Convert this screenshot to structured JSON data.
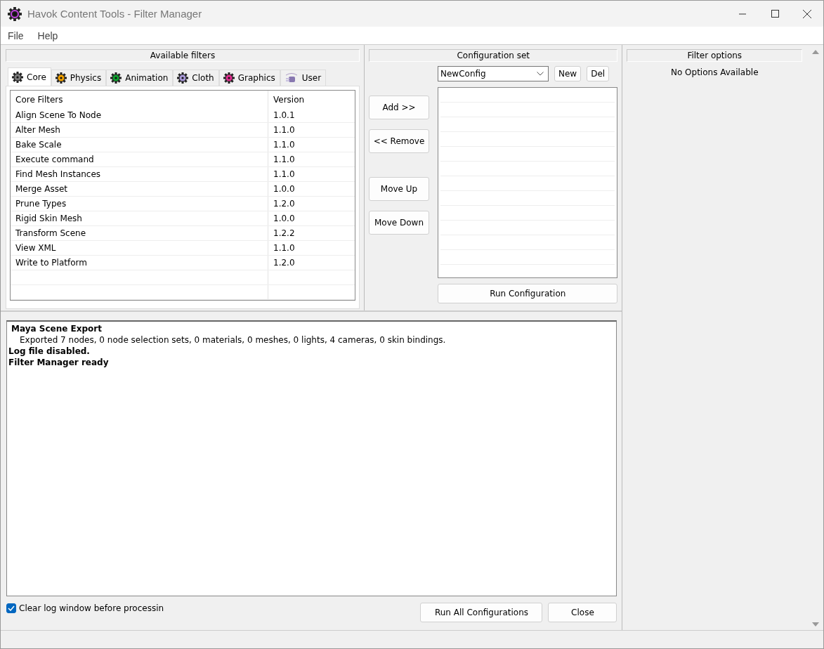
{
  "window": {
    "title": "Havok Content Tools - Filter Manager"
  },
  "menu": [
    "File",
    "Help"
  ],
  "available_filters": {
    "title": "Available filters",
    "tabs": [
      {
        "label": "Core",
        "selected": true,
        "color": "#7a7a7a"
      },
      {
        "label": "Physics",
        "selected": false,
        "color": "#f0a000"
      },
      {
        "label": "Animation",
        "selected": false,
        "color": "#10a030"
      },
      {
        "label": "Cloth",
        "selected": false,
        "color": "#a898d8"
      },
      {
        "label": "Graphics",
        "selected": false,
        "color": "#e03090"
      },
      {
        "label": "User",
        "selected": false
      }
    ],
    "table": {
      "columns": [
        "Core Filters",
        "Version"
      ],
      "rows": [
        [
          "Align Scene To Node",
          "1.0.1"
        ],
        [
          "Alter Mesh",
          "1.1.0"
        ],
        [
          "Bake Scale",
          "1.1.0"
        ],
        [
          "Execute command",
          "1.1.0"
        ],
        [
          "Find Mesh Instances",
          "1.1.0"
        ],
        [
          "Merge Asset",
          "1.0.0"
        ],
        [
          "Prune Types",
          "1.2.0"
        ],
        [
          "Rigid Skin Mesh",
          "1.0.0"
        ],
        [
          "Transform Scene",
          "1.2.2"
        ],
        [
          "View XML",
          "1.1.0"
        ],
        [
          "Write to Platform",
          "1.2.0"
        ]
      ]
    }
  },
  "move_buttons": [
    "Add >>",
    "<< Remove",
    "Move Up",
    "Move Down"
  ],
  "configuration_set": {
    "title": "Configuration set",
    "config": "NewConfig",
    "buttons": [
      "New",
      "Del"
    ],
    "run_button": "Run Configuration"
  },
  "filter_options": {
    "title": "Filter options",
    "message": "No Options Available"
  },
  "log": [
    {
      "kind": "heading",
      "text": "Maya Scene Export"
    },
    {
      "kind": "detail",
      "text": "Exported 7 nodes, 0 node selection sets, 0 materials, 0 meshes, 0 lights, 4 cameras, 0 skin bindings."
    },
    {
      "kind": "status",
      "text": "Log file disabled."
    },
    {
      "kind": "status",
      "text": "Filter Manager ready"
    }
  ],
  "clear_log": {
    "label": "Clear log window before processin",
    "checked": true
  },
  "bottom_buttons": [
    "Run All Configurations",
    "Close"
  ]
}
